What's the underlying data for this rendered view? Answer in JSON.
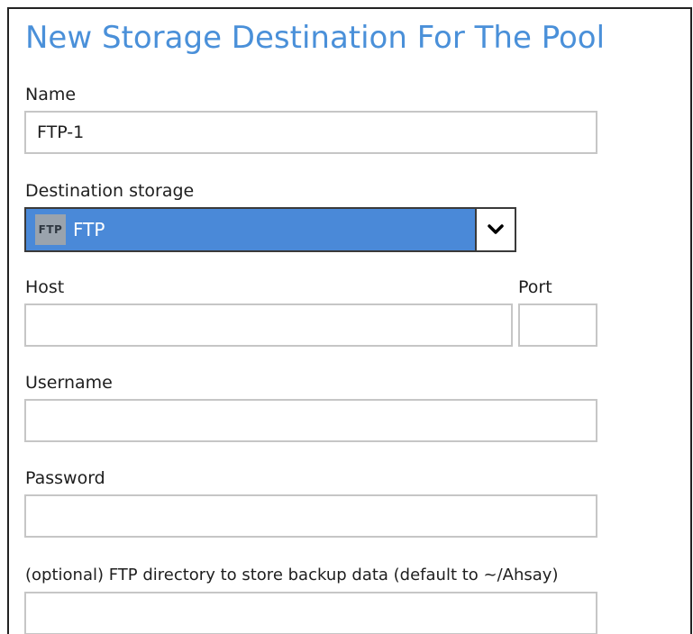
{
  "dialog": {
    "title": "New Storage Destination For The Pool"
  },
  "fields": {
    "name": {
      "label": "Name",
      "value": "FTP-1"
    },
    "destination_storage": {
      "label": "Destination storage",
      "selected": "FTP",
      "icon_text": "FTP"
    },
    "host": {
      "label": "Host",
      "value": ""
    },
    "port": {
      "label": "Port",
      "value": ""
    },
    "username": {
      "label": "Username",
      "value": ""
    },
    "password": {
      "label": "Password",
      "value": ""
    },
    "ftp_directory": {
      "label": "(optional) FTP directory to store backup data (default to ~/Ahsay)",
      "value": ""
    }
  },
  "colors": {
    "title": "#4a90d9",
    "select_background": "#4a89d8",
    "field_border": "#c6c6c6"
  },
  "icons": {
    "storage_type": "ftp-icon",
    "dropdown": "chevron-down-icon"
  }
}
